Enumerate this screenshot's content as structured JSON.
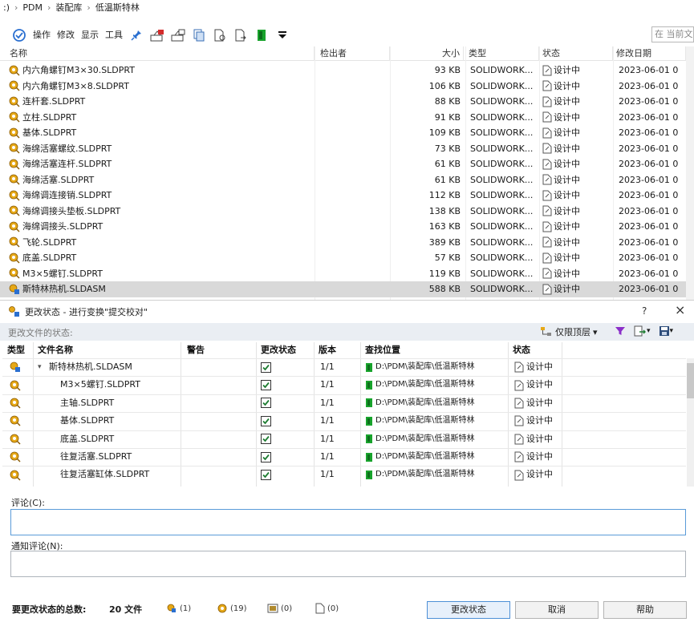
{
  "breadcrumb": {
    "lead": ":)",
    "items": [
      "PDM",
      "装配库",
      "低温斯特林"
    ]
  },
  "toolbar": {
    "menus": [
      "操作",
      "修改",
      "显示",
      "工具"
    ],
    "search_placeholder": "在 当前文"
  },
  "file_list": {
    "columns": {
      "name": "名称",
      "checked_out_by": "检出者",
      "size": "大小",
      "type": "类型",
      "state": "状态",
      "modified": "修改日期"
    },
    "rows": [
      {
        "name": "内六角螺钉M3×30.SLDPRT",
        "size": "93 KB",
        "type": "SOLIDWORK...",
        "state": "设计中",
        "date": "2023-06-01 0"
      },
      {
        "name": "内六角螺钉M3×8.SLDPRT",
        "size": "106 KB",
        "type": "SOLIDWORK...",
        "state": "设计中",
        "date": "2023-06-01 0"
      },
      {
        "name": "连杆套.SLDPRT",
        "size": "88 KB",
        "type": "SOLIDWORK...",
        "state": "设计中",
        "date": "2023-06-01 0"
      },
      {
        "name": "立柱.SLDPRT",
        "size": "91 KB",
        "type": "SOLIDWORK...",
        "state": "设计中",
        "date": "2023-06-01 0"
      },
      {
        "name": "基体.SLDPRT",
        "size": "109 KB",
        "type": "SOLIDWORK...",
        "state": "设计中",
        "date": "2023-06-01 0"
      },
      {
        "name": "海绵活塞螺纹.SLDPRT",
        "size": "73 KB",
        "type": "SOLIDWORK...",
        "state": "设计中",
        "date": "2023-06-01 0"
      },
      {
        "name": "海绵活塞连杆.SLDPRT",
        "size": "61 KB",
        "type": "SOLIDWORK...",
        "state": "设计中",
        "date": "2023-06-01 0"
      },
      {
        "name": "海绵活塞.SLDPRT",
        "size": "61 KB",
        "type": "SOLIDWORK...",
        "state": "设计中",
        "date": "2023-06-01 0"
      },
      {
        "name": "海绵调连接销.SLDPRT",
        "size": "112 KB",
        "type": "SOLIDWORK...",
        "state": "设计中",
        "date": "2023-06-01 0"
      },
      {
        "name": "海绵调接头垫板.SLDPRT",
        "size": "138 KB",
        "type": "SOLIDWORK...",
        "state": "设计中",
        "date": "2023-06-01 0"
      },
      {
        "name": "海绵调接头.SLDPRT",
        "size": "163 KB",
        "type": "SOLIDWORK...",
        "state": "设计中",
        "date": "2023-06-01 0"
      },
      {
        "name": "飞轮.SLDPRT",
        "size": "389 KB",
        "type": "SOLIDWORK...",
        "state": "设计中",
        "date": "2023-06-01 0"
      },
      {
        "name": "底盖.SLDPRT",
        "size": "57 KB",
        "type": "SOLIDWORK...",
        "state": "设计中",
        "date": "2023-06-01 0"
      },
      {
        "name": "M3×5螺钉.SLDPRT",
        "size": "119 KB",
        "type": "SOLIDWORK...",
        "state": "设计中",
        "date": "2023-06-01 0"
      },
      {
        "name": "斯特林热机.SLDASM",
        "size": "588 KB",
        "type": "SOLIDWORK...",
        "state": "设计中",
        "date": "2023-06-01 0",
        "selected": true
      }
    ]
  },
  "dialog": {
    "title": "更改状态 - 进行变换\"提交校对\"",
    "help": "?",
    "close": "×",
    "section_label": "更改文件的状态:",
    "filter_label": "仅限顶层",
    "columns": {
      "type": "类型",
      "filename": "文件名称",
      "warning": "警告",
      "change_state": "更改状态",
      "version": "版本",
      "found_in": "查找位置",
      "state": "状态"
    },
    "rows": [
      {
        "name": "斯特林热机.SLDASM",
        "version": "1/1",
        "path": "D:\\PDM\\装配库\\低温斯特林",
        "state": "设计中",
        "root": true,
        "checked": true
      },
      {
        "name": "M3×5螺钉.SLDPRT",
        "version": "1/1",
        "path": "D:\\PDM\\装配库\\低温斯特林",
        "state": "设计中",
        "checked": true
      },
      {
        "name": "主轴.SLDPRT",
        "version": "1/1",
        "path": "D:\\PDM\\装配库\\低温斯特林",
        "state": "设计中",
        "checked": true
      },
      {
        "name": "基体.SLDPRT",
        "version": "1/1",
        "path": "D:\\PDM\\装配库\\低温斯特林",
        "state": "设计中",
        "checked": true
      },
      {
        "name": "底盖.SLDPRT",
        "version": "1/1",
        "path": "D:\\PDM\\装配库\\低温斯特林",
        "state": "设计中",
        "checked": true
      },
      {
        "name": "往复活塞.SLDPRT",
        "version": "1/1",
        "path": "D:\\PDM\\装配库\\低温斯特林",
        "state": "设计中",
        "checked": true
      },
      {
        "name": "往复活塞缸体.SLDPRT",
        "version": "1/1",
        "path": "D:\\PDM\\装配库\\低温斯特林",
        "state": "设计中",
        "checked": true
      }
    ],
    "comment_label": "评论(C):",
    "comment_value": "",
    "notify_label": "通知评论(N):",
    "notify_value": "",
    "total_label": "要更改状态的总数:",
    "total_count": "20 文件",
    "counts": {
      "assemblies": "(1)",
      "parts": "(19)",
      "drawings": "(0)",
      "other": "(0)"
    },
    "buttons": {
      "change": "更改状态",
      "cancel": "取消",
      "help": "帮助"
    }
  },
  "colors": {
    "accent": "#4d8fd6",
    "selected_row": "#d9d9d9",
    "checkbox": "#1e7d32",
    "part_icon": "#e6a817",
    "folder_icon": "#18a32c"
  }
}
